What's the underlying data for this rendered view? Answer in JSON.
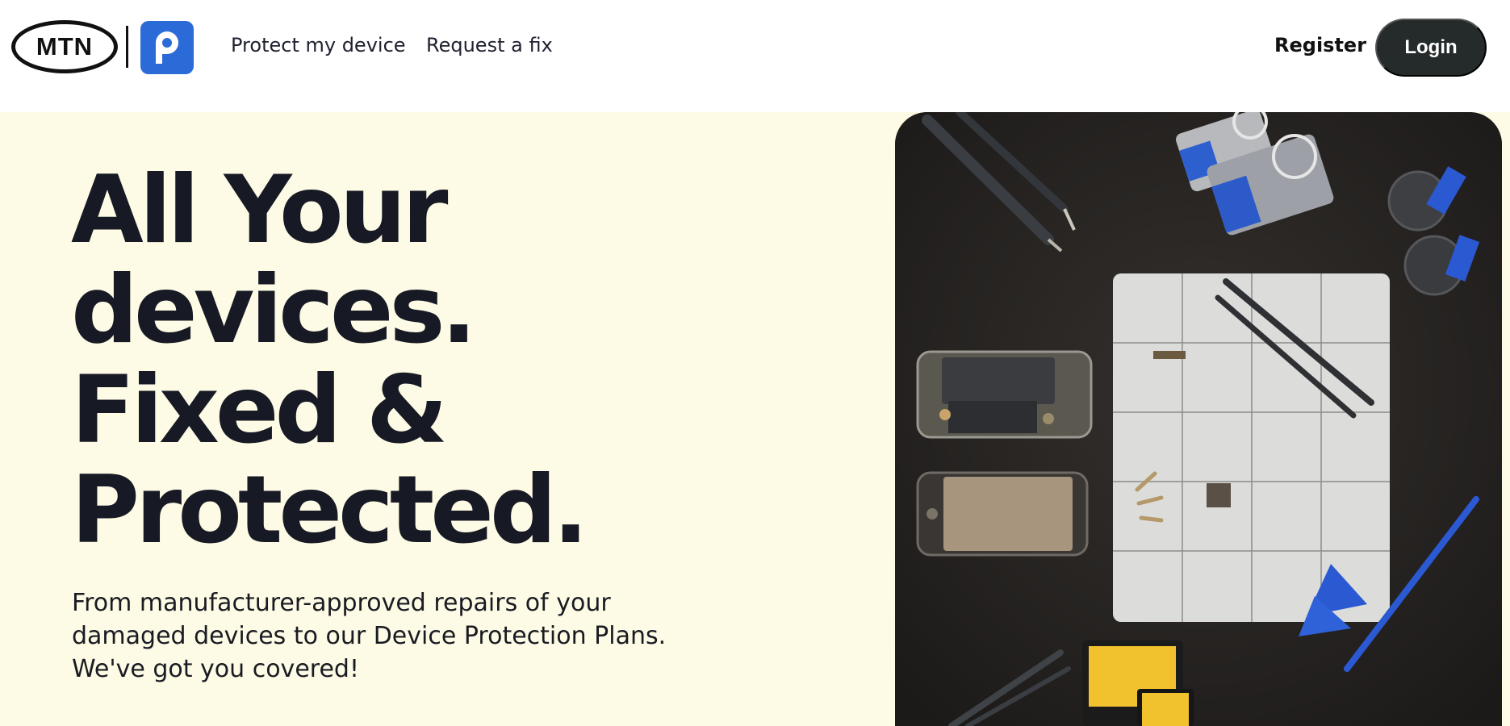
{
  "brand": {
    "mtn_text": "MTN",
    "app_icon": "p-location-pin-icon",
    "app_color": "#2a6bd8"
  },
  "nav": {
    "links": [
      {
        "label": "Protect my device"
      },
      {
        "label": "Request a fix"
      }
    ],
    "register_label": "Register",
    "login_label": "Login"
  },
  "hero": {
    "headline_lines": [
      "All Your",
      "devices.",
      "Fixed &",
      "Protected."
    ],
    "subtext_lines": [
      "From manufacturer-approved repairs of your",
      "damaged devices to our Device Protection Plans.",
      "We've got you covered!"
    ],
    "background": "#fdfbe5",
    "image": "device-repair-tools-photo"
  },
  "colors": {
    "login_bg": "#252a2a",
    "text": "#171a24"
  }
}
